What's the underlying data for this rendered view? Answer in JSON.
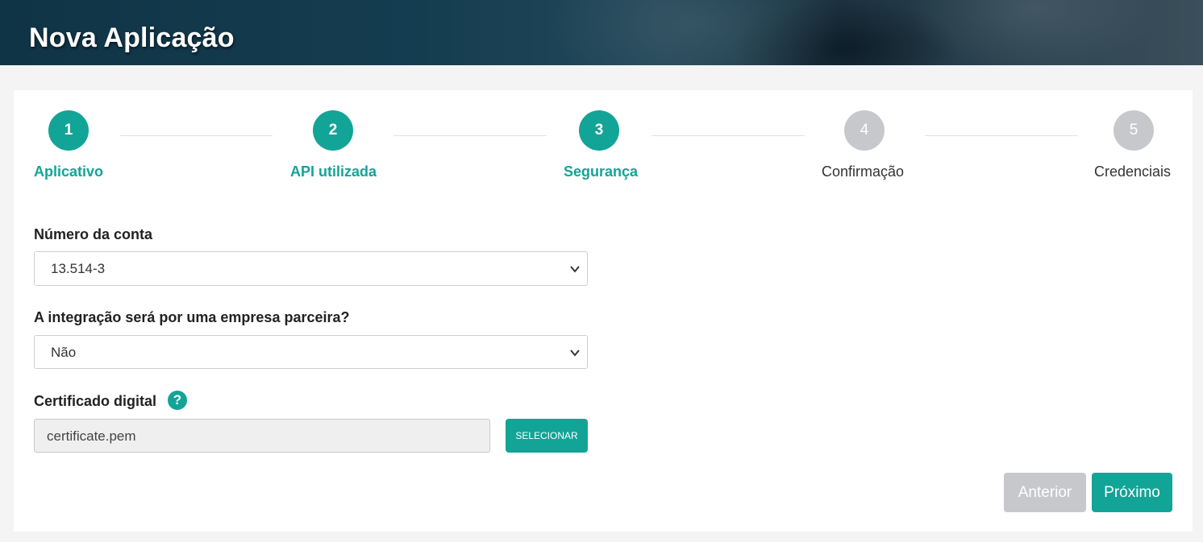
{
  "header": {
    "title": "Nova Aplicação"
  },
  "stepper": {
    "steps": [
      {
        "number": "1",
        "label": "Aplicativo",
        "status": "done"
      },
      {
        "number": "2",
        "label": "API utilizada",
        "status": "done"
      },
      {
        "number": "3",
        "label": "Segurança",
        "status": "current"
      },
      {
        "number": "4",
        "label": "Confirmação",
        "status": "pending"
      },
      {
        "number": "5",
        "label": "Credenciais",
        "status": "pending"
      }
    ]
  },
  "form": {
    "account": {
      "label": "Número da conta",
      "value": "13.514-3"
    },
    "partner": {
      "label": "A integração será por uma empresa parceira?",
      "value": "Não"
    },
    "certificate": {
      "label": "Certificado digital",
      "help_icon": "question-circle-icon",
      "help_glyph": "?",
      "value": "certificate.pem",
      "select_label": "SELECIONAR"
    }
  },
  "actions": {
    "previous_label": "Anterior",
    "next_label": "Próximo"
  },
  "colors": {
    "accent": "#12a497",
    "inactive": "#c6c8cc",
    "banner": "#153d50"
  }
}
